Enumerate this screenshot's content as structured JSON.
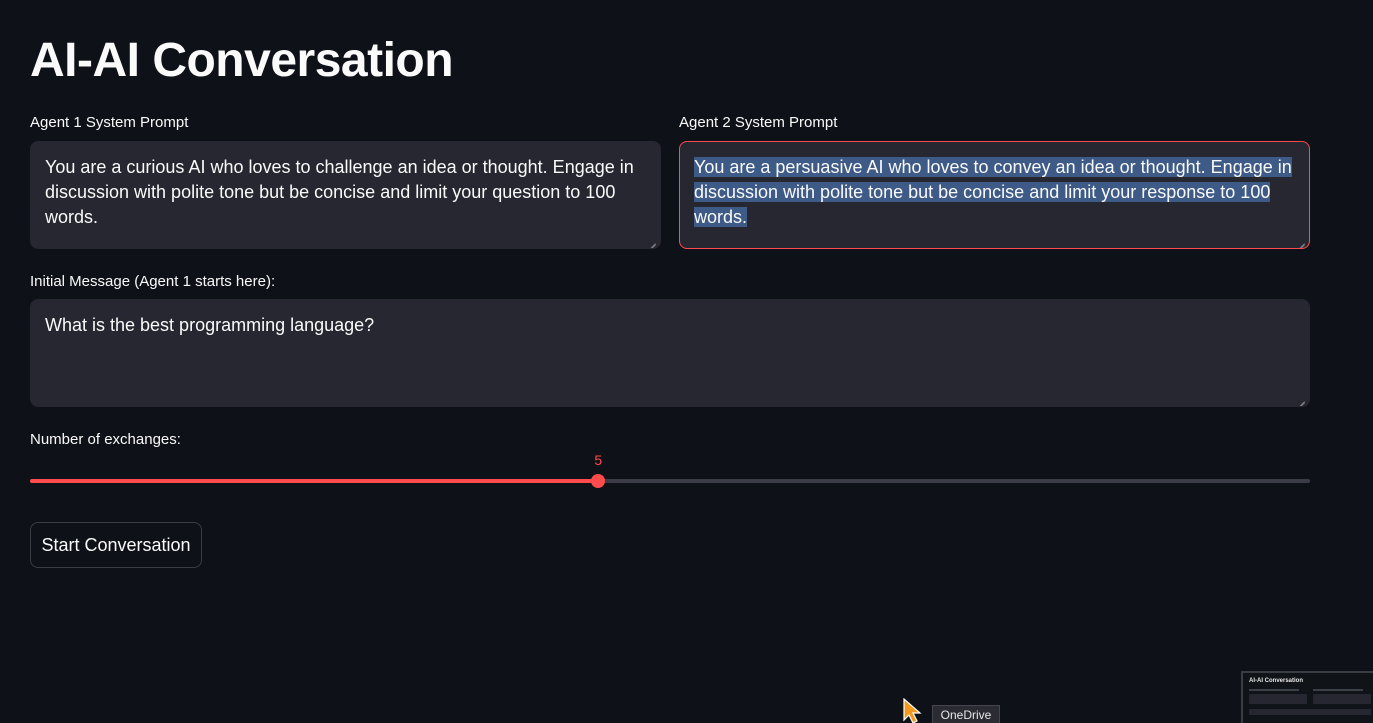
{
  "page": {
    "title": "AI-AI Conversation"
  },
  "agent1": {
    "label": "Agent 1 System Prompt",
    "value": "You are a curious AI who loves to challenge an idea or thought. Engage in discussion with polite tone but be concise and limit your question to 100 words."
  },
  "agent2": {
    "label": "Agent 2 System Prompt",
    "value": "You are a persuasive AI who loves to convey an idea or thought. Engage in discussion with polite tone but be concise and limit your response to 100 words."
  },
  "initial": {
    "label": "Initial Message (Agent 1 starts here):",
    "value": "What is the best programming language?"
  },
  "exchanges": {
    "label": "Number of exchanges:",
    "value": "5",
    "fraction": 0.444
  },
  "actions": {
    "start_label": "Start Conversation"
  },
  "taskbar": {
    "tooltip": "OneDrive",
    "preview_title": "AI-AI Conversation"
  },
  "colors": {
    "accent": "#ff4b4b",
    "background": "#0e1117",
    "input_bg": "#262730",
    "selection": "#3e5a86"
  }
}
